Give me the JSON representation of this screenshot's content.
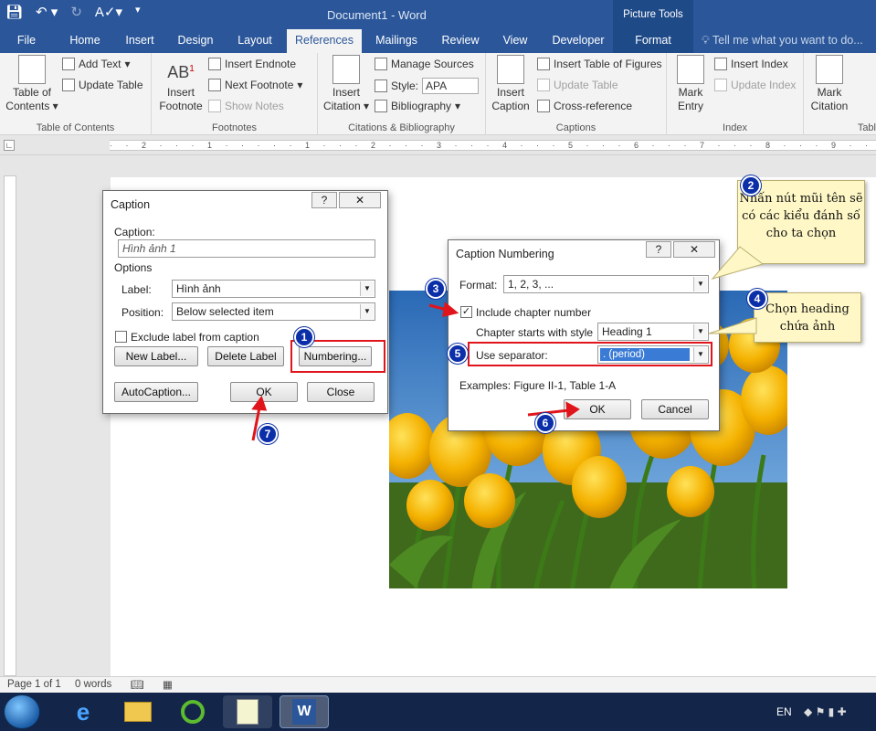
{
  "app": {
    "title": "Document1 - Word",
    "picture_tools": "Picture Tools",
    "tell_me": "Tell me what you want to do..."
  },
  "tabs": [
    {
      "label": "File"
    },
    {
      "label": "Home"
    },
    {
      "label": "Insert"
    },
    {
      "label": "Design"
    },
    {
      "label": "Layout"
    },
    {
      "label": "References"
    },
    {
      "label": "Mailings"
    },
    {
      "label": "Review"
    },
    {
      "label": "View"
    },
    {
      "label": "Developer"
    },
    {
      "label": "Format"
    }
  ],
  "ribbon": {
    "toc": {
      "big": "Table of Contents",
      "add_text": "Add Text",
      "update_table": "Update Table",
      "group": "Table of Contents"
    },
    "footnotes": {
      "big": "Insert Footnote",
      "insert_endnote": "Insert Endnote",
      "next_footnote": "Next Footnote",
      "show_notes": "Show Notes",
      "group": "Footnotes"
    },
    "citations": {
      "big": "Insert Citation",
      "manage_sources": "Manage Sources",
      "style_label": "Style:",
      "style_value": "APA",
      "bibliography": "Bibliography",
      "group": "Citations & Bibliography"
    },
    "captions": {
      "big": "Insert Caption",
      "insert_tof": "Insert Table of Figures",
      "update_table": "Update Table",
      "cross_ref": "Cross-reference",
      "group": "Captions"
    },
    "index": {
      "big": "Mark Entry",
      "insert_index": "Insert Index",
      "update_index": "Update Index",
      "group": "Index"
    },
    "toa": {
      "big": "Mark Citation",
      "group": "Tabl"
    }
  },
  "caption_dialog": {
    "title": "Caption",
    "help": "?",
    "close": "✕",
    "caption_label": "Caption:",
    "caption_value": "Hình ảnh 1",
    "options_label": "Options",
    "label_label": "Label:",
    "label_value": "Hình ảnh",
    "position_label": "Position:",
    "position_value": "Below selected item",
    "exclude_label": "Exclude label from caption",
    "new_label": "New Label...",
    "delete_label": "Delete Label",
    "numbering": "Numbering...",
    "autocaption": "AutoCaption...",
    "ok": "OK",
    "close_btn": "Close"
  },
  "numbering_dialog": {
    "title": "Caption Numbering",
    "help": "?",
    "close": "✕",
    "format_label": "Format:",
    "format_value": "1, 2, 3, ...",
    "include_chapter": "Include chapter number",
    "chapter_starts_label": "Chapter starts with style",
    "chapter_starts_value": "Heading 1",
    "separator_label": "Use separator:",
    "separator_value": ".   (period)",
    "examples": "Examples:   Figure II-1, Table 1-A",
    "ok": "OK",
    "cancel": "Cancel"
  },
  "annotations": {
    "badges": [
      "1",
      "2",
      "3",
      "4",
      "5",
      "6",
      "7"
    ],
    "note2": "Nhấn nút mũi tên sẽ có các kiểu đánh số cho ta chọn",
    "note4": "Chọn heading chứa ảnh"
  },
  "status": {
    "page": "Page 1 of 1",
    "words": "0 words",
    "lang": "EN"
  },
  "colors": {
    "word_blue": "#2b579a",
    "badge_blue": "#0b2fa8",
    "highlight_red": "#e0151b",
    "note_yellow": "#fff8c6",
    "tulip": "#f2b705"
  }
}
